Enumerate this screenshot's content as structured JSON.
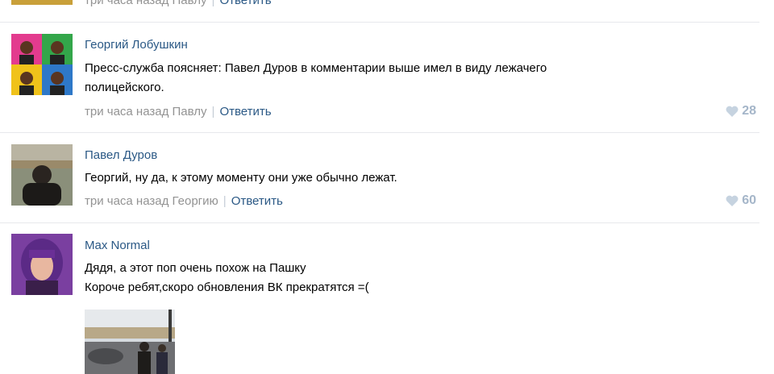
{
  "top": {
    "time": "три часа назад Павлу",
    "reply": "Ответить"
  },
  "comments": [
    {
      "author": "Георгий Лобушкин",
      "text_lines": [
        "Пресс-служба поясняет: Павел Дуров в комментарии выше имел в виду лежачего",
        "полицейского."
      ],
      "time": "три часа назад Павлу",
      "reply": "Ответить",
      "likes": "28"
    },
    {
      "author": "Павел Дуров",
      "text_lines": [
        "Георгий, ну да, к этому моменту они уже обычно лежат."
      ],
      "time": "три часа назад Георгию",
      "reply": "Ответить",
      "likes": "60"
    },
    {
      "author": "Max Normal",
      "text_lines": [
        "Дядя, а этот поп очень похож на Пашку",
        "Короче ребят,скоро обновления ВК прекратятся =("
      ]
    }
  ],
  "colors": {
    "link": "#2a5885",
    "meta": "#939393",
    "like": "#a5b6c9",
    "divider": "#e7e8ec"
  },
  "icons": [
    "heart-icon"
  ]
}
